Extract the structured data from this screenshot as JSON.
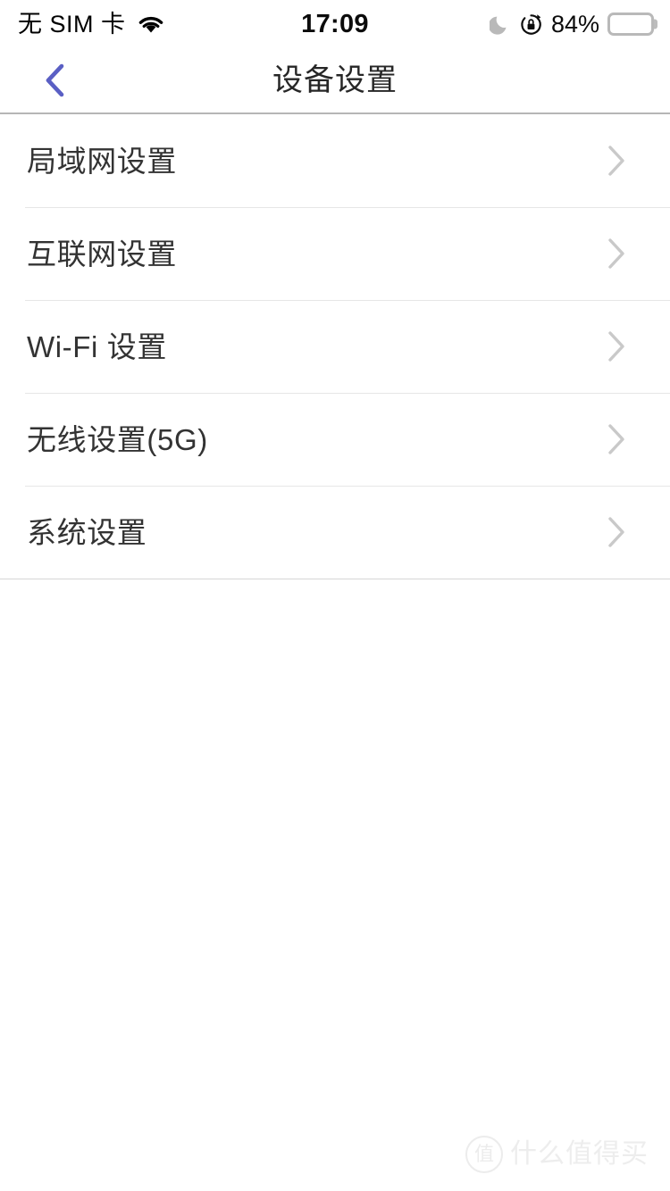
{
  "status_bar": {
    "carrier": "无 SIM 卡",
    "wifi_icon": "wifi-icon",
    "time": "17:09",
    "dnd_icon": "moon-icon",
    "rotation_lock_icon": "rotation-lock-icon",
    "battery_percent": "84%",
    "battery_level": 84
  },
  "nav_bar": {
    "back_icon": "chevron-left-icon",
    "back_color": "#5a5fc4",
    "title": "设备设置"
  },
  "settings_list": {
    "chevron_icon": "chevron-right-icon",
    "items": [
      {
        "label": "局域网设置"
      },
      {
        "label": "互联网设置"
      },
      {
        "label": "Wi-Fi 设置"
      },
      {
        "label": "无线设置(5G)"
      },
      {
        "label": "系统设置"
      }
    ]
  },
  "watermark": {
    "logo_text": "值",
    "text": "什么值得买"
  }
}
